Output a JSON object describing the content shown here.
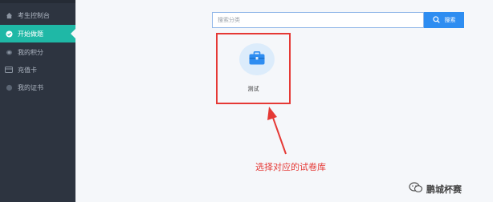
{
  "sidebar": {
    "items": [
      {
        "label": "考生控制台",
        "icon": "home-icon",
        "active": false
      },
      {
        "label": "开始做题",
        "icon": "check-circle-icon",
        "active": true
      },
      {
        "label": "我的积分",
        "icon": "coin-icon",
        "active": false
      },
      {
        "label": "充值卡",
        "icon": "card-icon",
        "active": false
      },
      {
        "label": "我的证书",
        "icon": "certificate-icon",
        "active": false
      }
    ]
  },
  "search": {
    "placeholder": "搜索分类",
    "button_label": "搜索",
    "button_icon": "search-icon"
  },
  "categories": [
    {
      "label": "测试",
      "icon": "briefcase-icon"
    }
  ],
  "annotation": {
    "text": "选择对应的试卷库",
    "color": "#e53935"
  },
  "watermark": {
    "text": "鹏城杯赛"
  },
  "colors": {
    "sidebar_bg": "#2d3440",
    "active_bg": "#1fb8a6",
    "accent": "#2e8df1",
    "highlight": "#e53935"
  }
}
